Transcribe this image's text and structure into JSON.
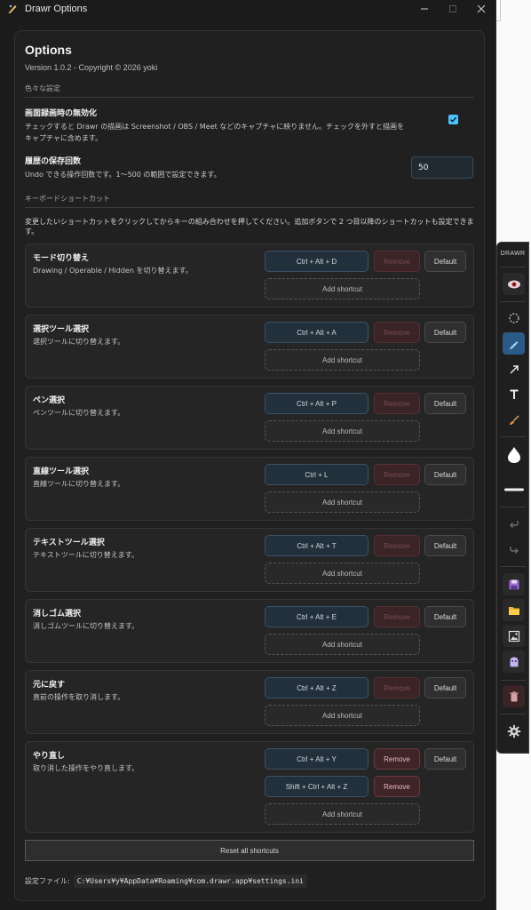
{
  "window": {
    "title": "Drawr Options"
  },
  "options": {
    "heading": "Options",
    "version": "Version 1.0.2 - Copyright © 2026 yoki",
    "section_misc": "色々な設定",
    "disable_capture": {
      "label": "画面録画時の無効化",
      "desc": "チェックすると Drawr の描画は Screenshot / OBS / Meet などのキャプチャに映りません。チェックを外すと描画をキャプチャに含めます。",
      "checked": true
    },
    "history": {
      "label": "履歴の保存回数",
      "desc": "Undo できる操作回数です。1〜500 の範囲で設定できます。",
      "value": "50"
    },
    "section_shortcuts": "キーボードショートカット",
    "shortcut_hint": "変更したいショートカットをクリックしてからキーの組み合わせを押してください。追加ボタンで 2 つ目以降のショートカットも設定できます。",
    "labels": {
      "remove": "Remove",
      "default": "Default",
      "add": "Add shortcut"
    },
    "shortcuts": [
      {
        "name": "モード切り替え",
        "desc": "Drawing / Operable / Hidden を切り替えます。",
        "keys": [
          "Ctrl + Alt + D"
        ]
      },
      {
        "name": "選択ツール選択",
        "desc": "選択ツールに切り替えます。",
        "keys": [
          "Ctrl + Alt + A"
        ]
      },
      {
        "name": "ペン選択",
        "desc": "ペンツールに切り替えます。",
        "keys": [
          "Ctrl + Alt + P"
        ]
      },
      {
        "name": "直線ツール選択",
        "desc": "直線ツールに切り替えます。",
        "keys": [
          "Ctrl + L"
        ]
      },
      {
        "name": "テキストツール選択",
        "desc": "テキストツールに切り替えます。",
        "keys": [
          "Ctrl + Alt + T"
        ]
      },
      {
        "name": "消しゴム選択",
        "desc": "消しゴムツールに切り替えます。",
        "keys": [
          "Ctrl + Alt + E"
        ]
      },
      {
        "name": "元に戻す",
        "desc": "直前の操作を取り消します。",
        "keys": [
          "Ctrl + Alt + Z"
        ]
      },
      {
        "name": "やり直し",
        "desc": "取り消した操作をやり直します。",
        "keys": [
          "Ctrl + Alt + Y",
          "Shift + Ctrl + Alt + Z"
        ]
      }
    ],
    "reset_label": "Reset all shortcuts",
    "settings_file_label": "設定ファイル:",
    "settings_file_path": "C:¥Users¥y¥AppData¥Roaming¥com.drawr.app¥settings.ini"
  },
  "toolbar": {
    "title": "DRAWR",
    "tools": [
      "eye-icon",
      "lasso-select-icon",
      "pen-icon",
      "arrow-icon",
      "text-icon",
      "brush-icon",
      "opacity-drop-icon",
      "stroke-width-icon",
      "undo-icon",
      "redo-icon",
      "save-icon",
      "open-folder-icon",
      "image-icon",
      "ghost-icon",
      "trash-icon",
      "settings-icon"
    ],
    "active_tool": "pen-icon"
  },
  "colors": {
    "accent": "#4cc2ff",
    "key_button": "#22303c",
    "remove": "#3a2426"
  }
}
